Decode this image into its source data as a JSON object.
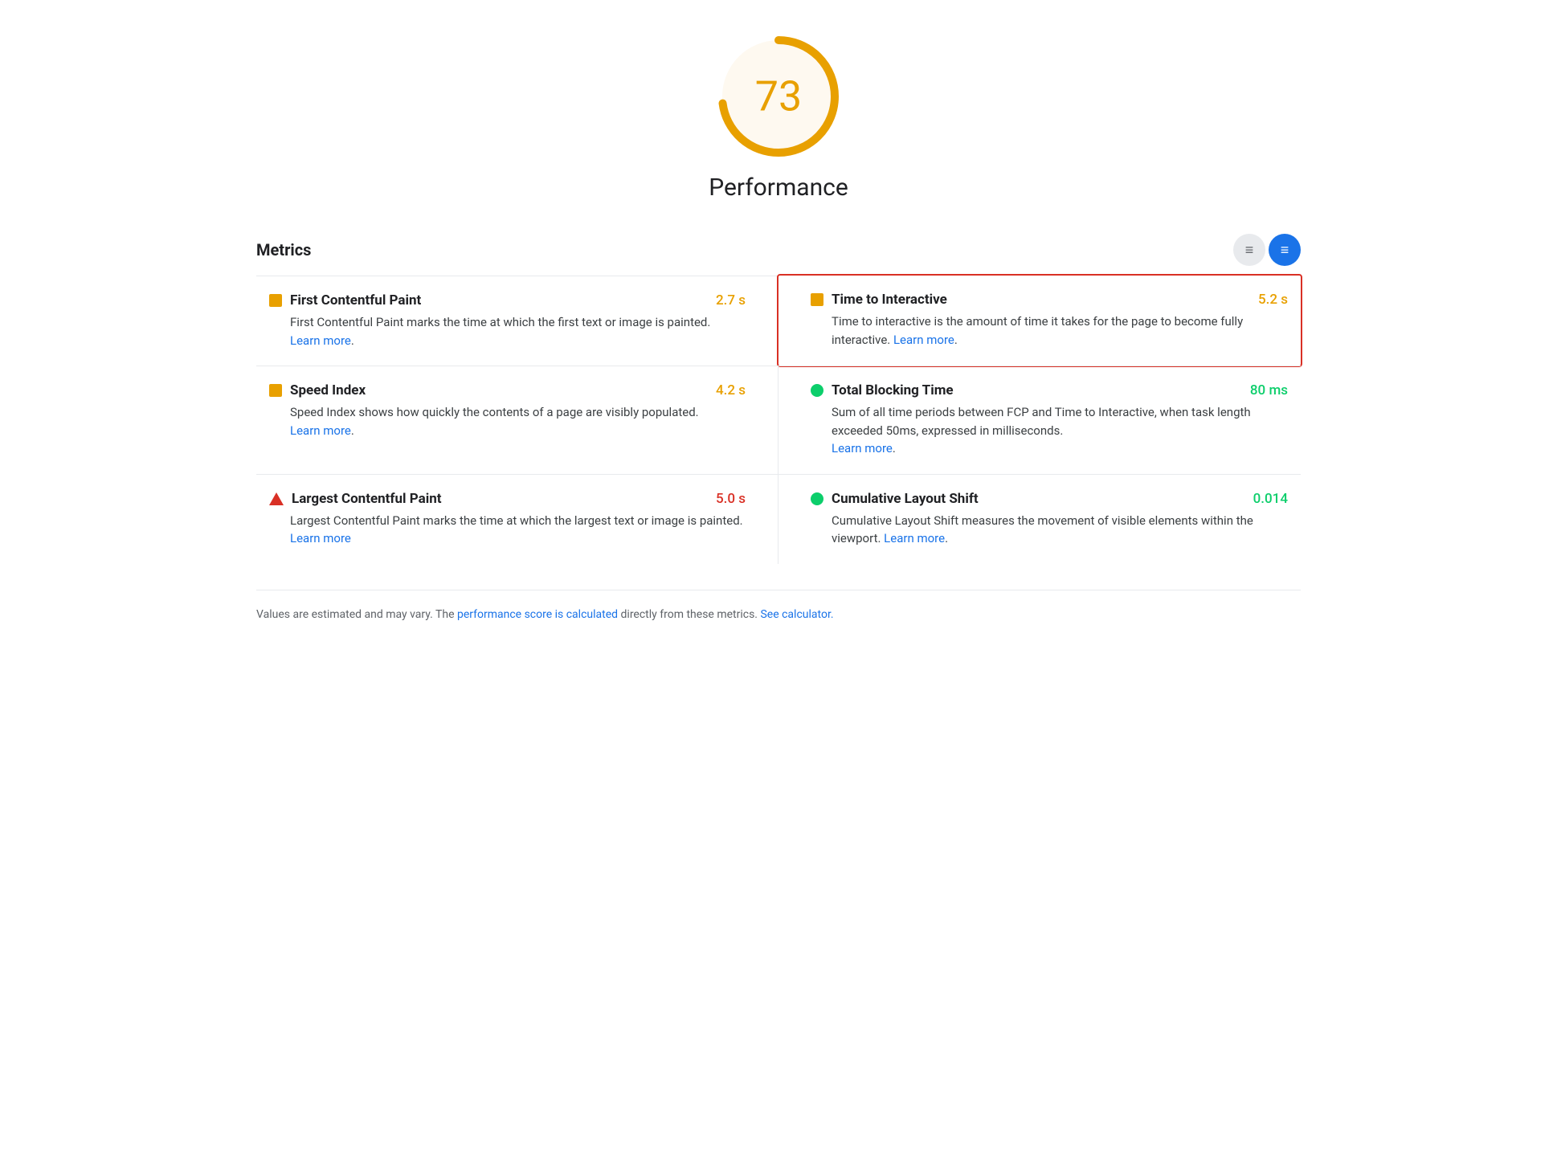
{
  "score": {
    "value": "73",
    "label": "Performance",
    "color": "#e8a000",
    "bg_color": "#fef9f0",
    "arc_percent": 73
  },
  "metrics": {
    "title": "Metrics",
    "toggle": {
      "list_label": "≡",
      "detail_label": "≡"
    },
    "items": [
      {
        "id": "fcp",
        "name": "First Contentful Paint",
        "description": "First Contentful Paint marks the time at which the first text or image is painted.",
        "learn_more_text": "Learn more",
        "learn_more_url": "#",
        "value": "2.7 s",
        "value_color": "orange",
        "icon_type": "square-orange",
        "highlighted": false,
        "position": "left"
      },
      {
        "id": "tti",
        "name": "Time to Interactive",
        "description": "Time to interactive is the amount of time it takes for the page to become fully interactive.",
        "learn_more_text": "Learn more",
        "learn_more_url": "#",
        "value": "5.2 s",
        "value_color": "orange",
        "icon_type": "square-orange",
        "highlighted": true,
        "position": "right"
      },
      {
        "id": "si",
        "name": "Speed Index",
        "description": "Speed Index shows how quickly the contents of a page are visibly populated.",
        "learn_more_text": "Learn more",
        "learn_more_url": "#",
        "value": "4.2 s",
        "value_color": "orange",
        "icon_type": "square-orange",
        "highlighted": false,
        "position": "left"
      },
      {
        "id": "tbt",
        "name": "Total Blocking Time",
        "description": "Sum of all time periods between FCP and Time to Interactive, when task length exceeded 50ms, expressed in milliseconds.",
        "learn_more_text": "Learn more",
        "learn_more_url": "#",
        "value": "80 ms",
        "value_color": "green",
        "icon_type": "circle-green",
        "highlighted": false,
        "position": "right"
      },
      {
        "id": "lcp",
        "name": "Largest Contentful Paint",
        "description": "Largest Contentful Paint marks the time at which the largest text or image is painted.",
        "learn_more_text": "Learn more",
        "learn_more_url": "#",
        "value": "5.0 s",
        "value_color": "red",
        "icon_type": "triangle-red",
        "highlighted": false,
        "position": "left"
      },
      {
        "id": "cls",
        "name": "Cumulative Layout Shift",
        "description": "Cumulative Layout Shift measures the movement of visible elements within the viewport.",
        "learn_more_text": "Learn more",
        "learn_more_url": "#",
        "value": "0.014",
        "value_color": "green",
        "icon_type": "circle-green",
        "highlighted": false,
        "position": "right"
      }
    ]
  },
  "footer": {
    "text_before": "Values are estimated and may vary. The ",
    "link1_text": "performance score is calculated",
    "link1_url": "#",
    "text_between": " directly from these metrics. ",
    "link2_text": "See calculator.",
    "link2_url": "#"
  }
}
